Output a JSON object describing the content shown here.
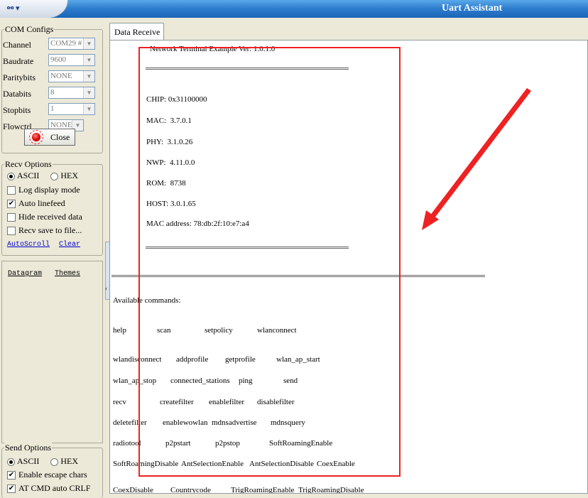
{
  "window": {
    "title": "Uart Assistant",
    "menu_glyph": "⚯ ▾"
  },
  "com_configs": {
    "title": "COM Configs",
    "fields": [
      {
        "label": "Channel",
        "value": "COM29 #"
      },
      {
        "label": "Baudrate",
        "value": "9600"
      },
      {
        "label": "Paritybits",
        "value": "NONE"
      },
      {
        "label": "Databits",
        "value": "8"
      },
      {
        "label": "Stopbits",
        "value": "1"
      },
      {
        "label": "Flowctrl",
        "value": "NONE"
      }
    ],
    "close_label": "Close"
  },
  "recv_options": {
    "title": "Recv Options",
    "radio_ascii": "ASCII",
    "radio_hex": "HEX",
    "checks": [
      {
        "label": "Log display mode",
        "checked": false
      },
      {
        "label": "Auto linefeed",
        "checked": true
      },
      {
        "label": "Hide received data",
        "checked": false
      },
      {
        "label": "Recv save to file...",
        "checked": false
      }
    ],
    "autoscroll": "AutoScroll",
    "clear": "Clear"
  },
  "extra_panel": {
    "datagram": "Datagram",
    "themes": "Themes"
  },
  "send_options": {
    "title": "Send Options",
    "radio_ascii": "ASCII",
    "radio_hex": "HEX",
    "checks": [
      {
        "label": "Enable escape chars",
        "checked": true
      },
      {
        "label": "AT CMD auto CRLF",
        "checked": true
      }
    ]
  },
  "tab": {
    "label": "Data Receive"
  },
  "terminal": {
    "header": "Network Terminal Example Ver: 1.0.1.0",
    "sep_short": "=============================================",
    "chip": "CHIP: 0x31100000",
    "mac": "MAC:  3.7.0.1",
    "phy": "PHY:  3.1.0.26",
    "nwp": "NWP:  4.11.0.0",
    "rom": "ROM:  8738",
    "host": "HOST: 3.0.1.65",
    "mac_address": "MAC address: 78:db:2f:10:e7:a4",
    "sep_long": "==========================================================================",
    "available": "Available commands:",
    "commands": [
      [
        "help",
        "scan",
        "setpolicy",
        "wlanconnect"
      ],
      [
        "wlandisconnect",
        "addprofile",
        "getprofile",
        "wlan_ap_start"
      ],
      [
        "wlan_ap_stop",
        "connected_stations",
        "ping",
        "send"
      ],
      [
        "recv",
        "createfilter",
        "enablefilter",
        "disablefilter"
      ],
      [
        "deletefilter",
        "enablewowlan",
        "mdnsadvertise",
        "mdnsquery"
      ],
      [
        "radiotool",
        "p2pstart",
        "p2pstop",
        "SoftRoamingEnable"
      ],
      [
        "SoftRoamingDisable",
        "AntSelectionEnable",
        "AntSelectionDisable",
        "CoexEnable"
      ],
      [
        "CoexDisable",
        "Countrycode",
        "TrigRoamingEnable",
        "TrigRoamingDisable"
      ]
    ]
  },
  "colors": {
    "annotation_red": "#ee2222",
    "title_blue": "#2f7fd0"
  }
}
